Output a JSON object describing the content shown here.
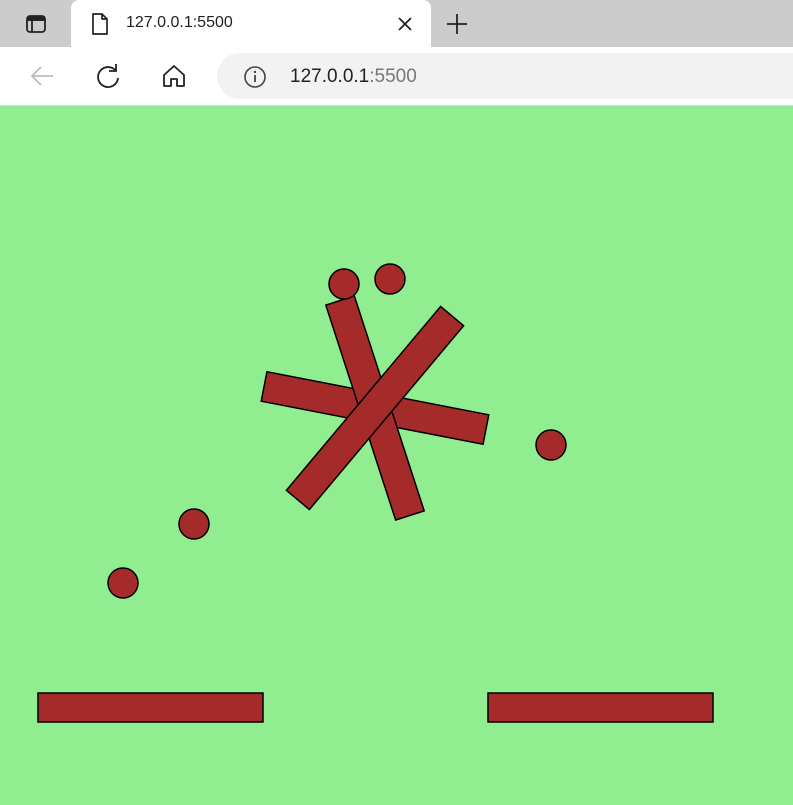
{
  "browser": {
    "tab_title": "127.0.0.1:5500",
    "url_host": "127.0.0.1",
    "url_port": ":5500"
  },
  "icons": {
    "tab_actions": "tab-actions-icon",
    "page": "page-icon",
    "close": "close-icon",
    "new_tab": "plus-icon",
    "back": "back-arrow-icon",
    "refresh": "refresh-icon",
    "home": "home-icon",
    "site_info": "info-icon"
  },
  "scene": {
    "background_color": "#90ee90",
    "object_color": "#a52a2a",
    "outline_color": "#000000"
  }
}
